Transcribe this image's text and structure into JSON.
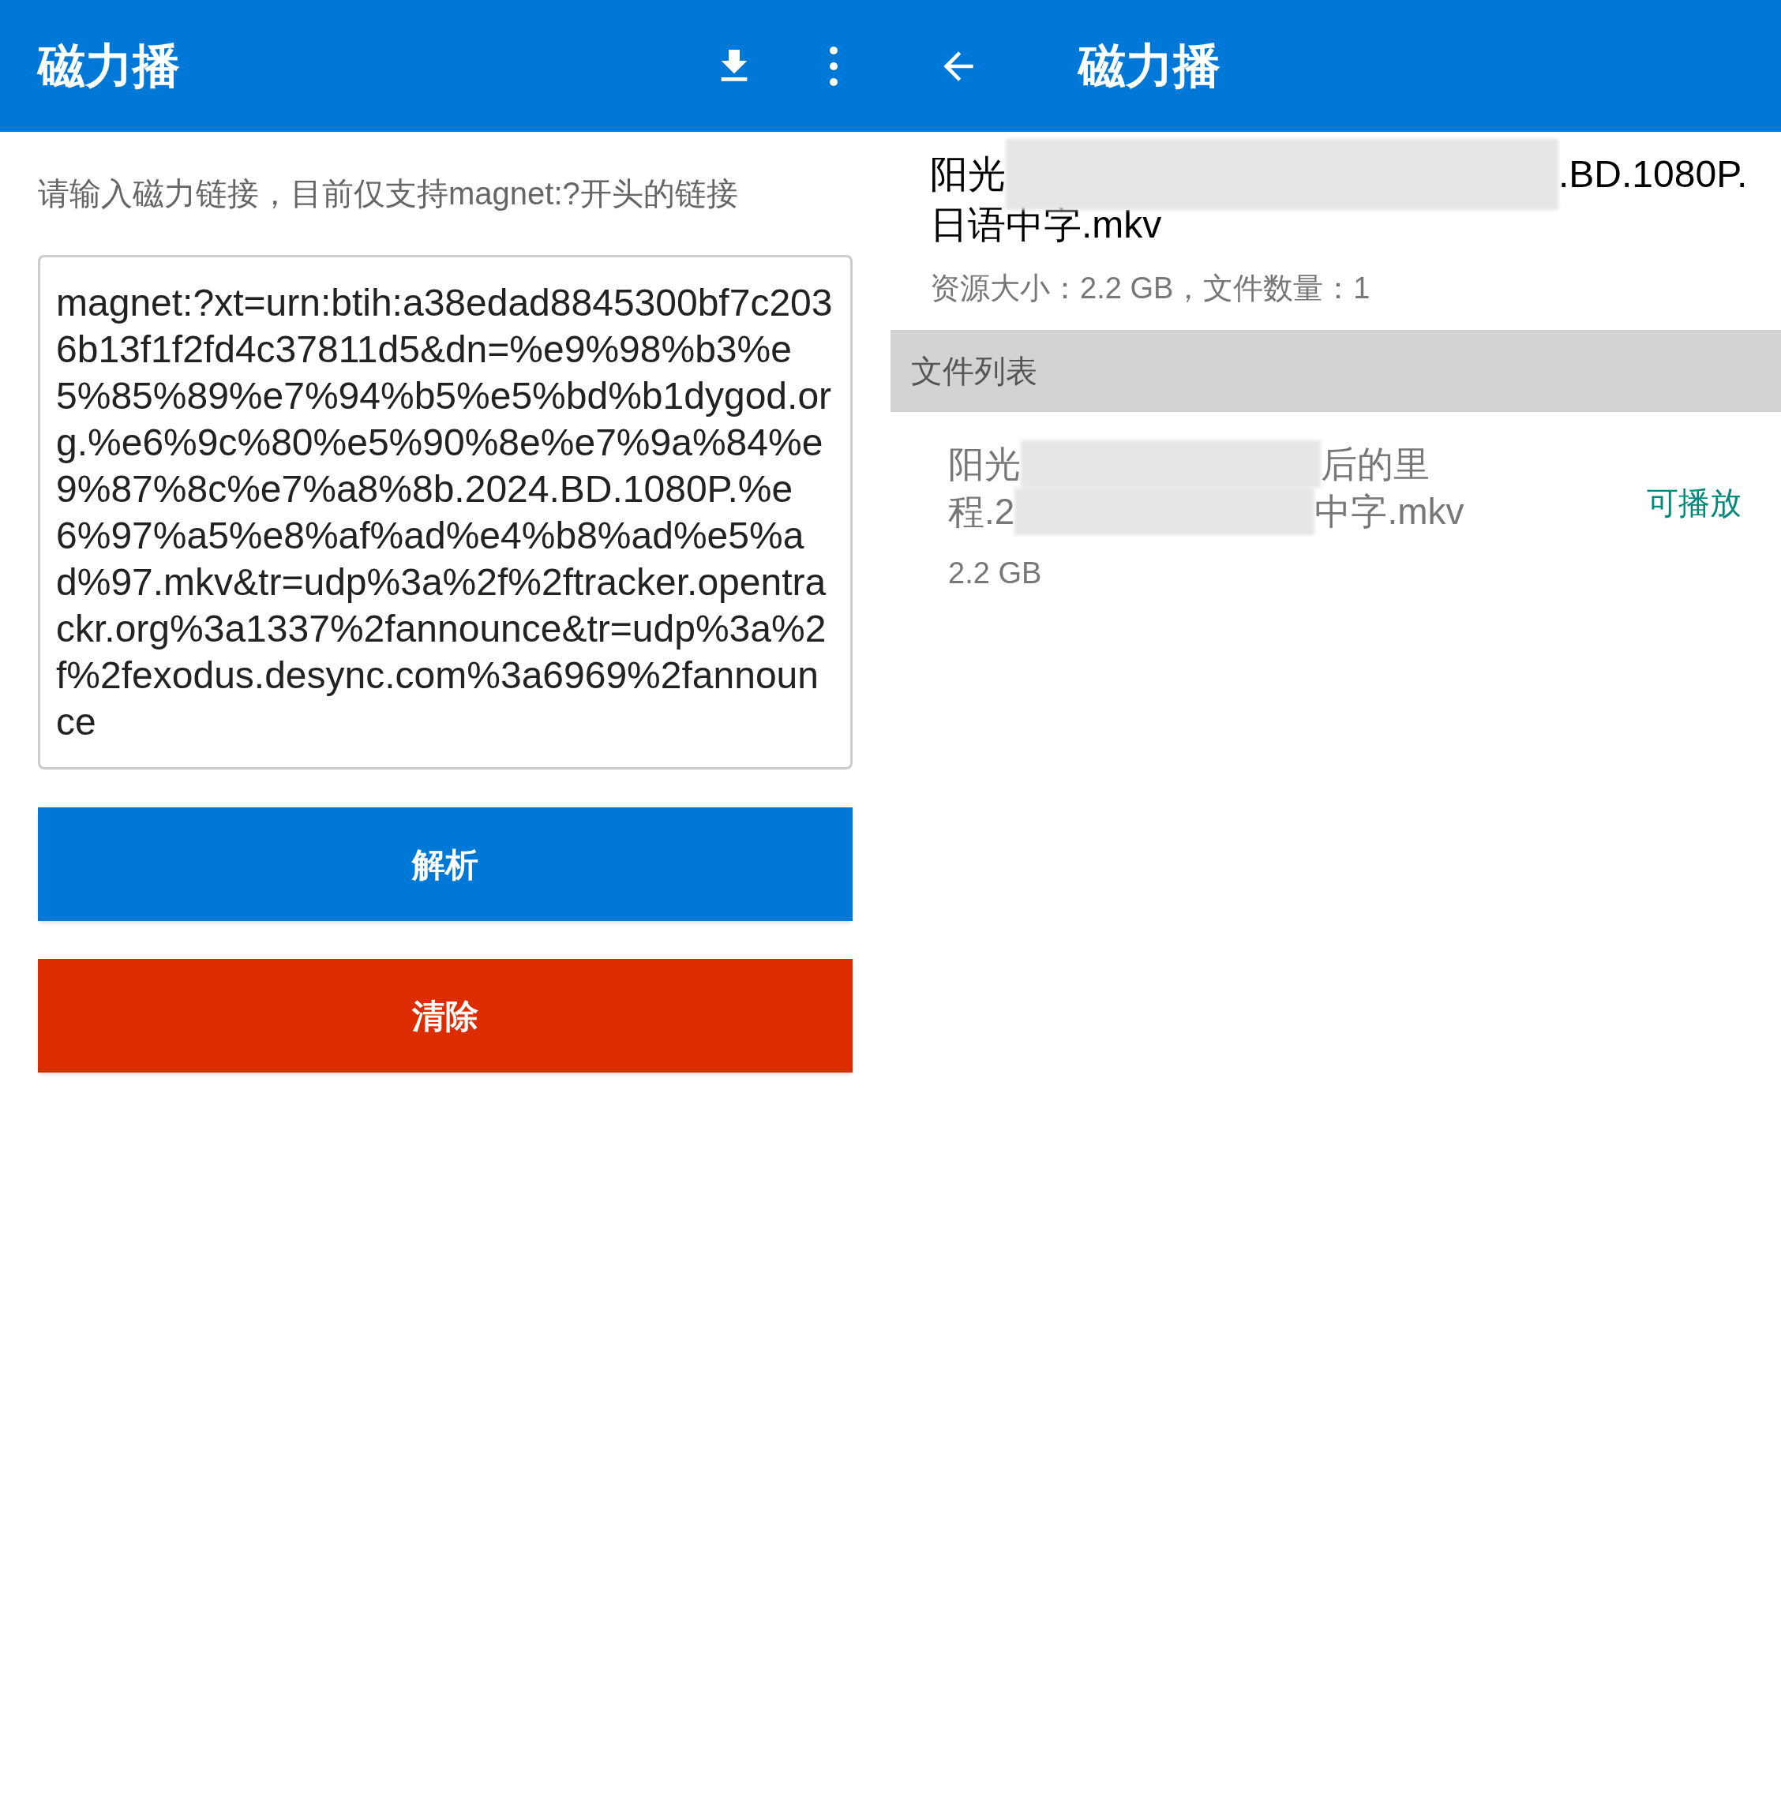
{
  "left_screen": {
    "app_bar": {
      "title": "磁力播"
    },
    "hint": "请输入磁力链接，目前仅支持magnet:?开头的链接",
    "magnet_field": {
      "value": "magnet:?xt=urn:btih:a38edad8845300bf7c2036b13f1f2fd4c37811d5&dn=%e9%98%b3%e5%85%89%e7%94%b5%e5%bd%b1dygod.org.%e6%9c%80%e5%90%8e%e7%9a%84%e9%87%8c%e7%a8%8b.2024.BD.1080P.%e6%97%a5%e8%af%ad%e4%b8%ad%e5%ad%97.mkv&tr=udp%3a%2f%2ftracker.opentrackr.org%3a1337%2fannounce&tr=udp%3a%2f%2fexodus.desync.com%3a6969%2fannounce"
    },
    "buttons": [
      {
        "label": "解析",
        "kind": "primary"
      },
      {
        "label": "清除",
        "kind": "danger"
      }
    ]
  },
  "right_screen": {
    "app_bar": {
      "title": "磁力播"
    },
    "resource_title": {
      "line_1_start": "阳光",
      "line_1_end": ".BD.1080P.",
      "line_2": "日语中字.mkv"
    },
    "info": "资源大小：2.2 GB，文件数量：1",
    "section_header": "文件列表",
    "files": [
      {
        "name_line_1_start": "阳光",
        "name_line_1_end": "后的里",
        "name_line_2_start": "程.2",
        "name_line_2_end": "中字.mkv",
        "size": "2.2 GB",
        "status": "可播放"
      }
    ]
  }
}
